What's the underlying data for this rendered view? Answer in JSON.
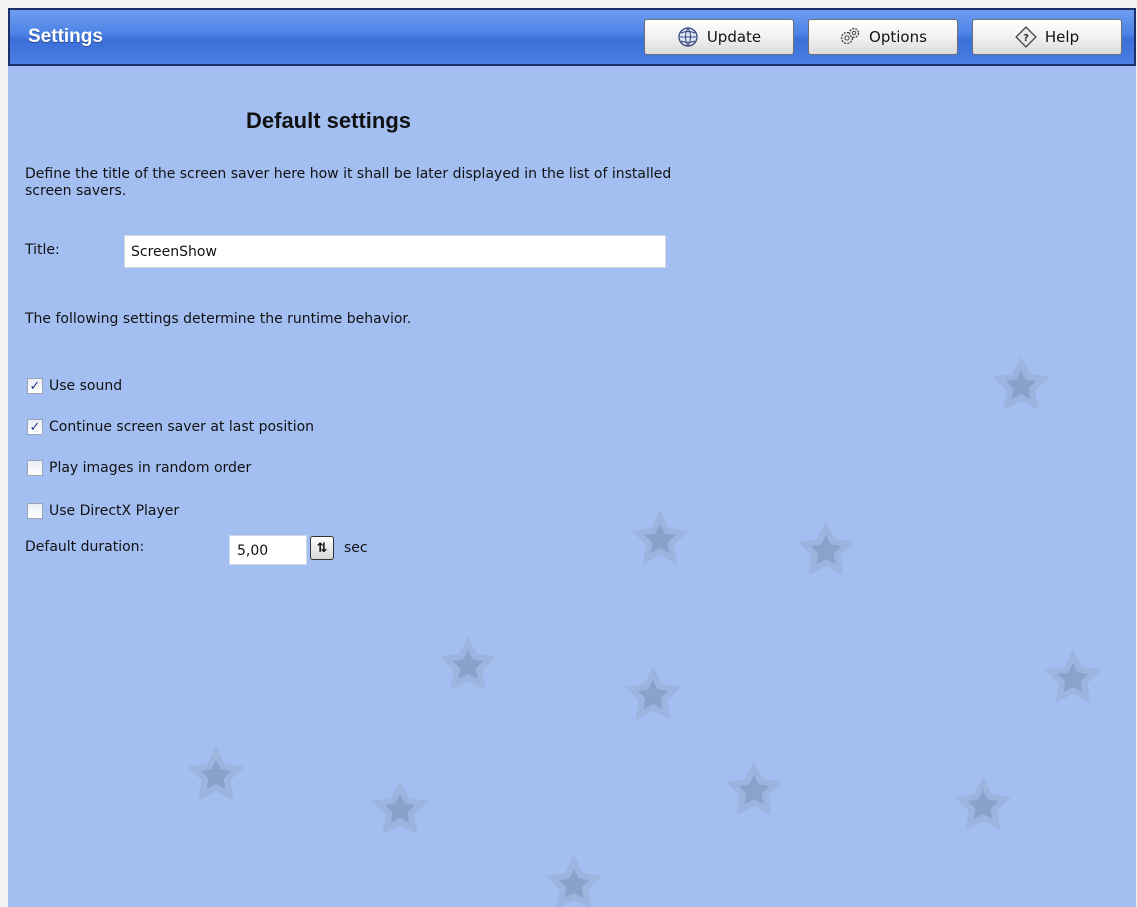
{
  "window": {
    "title": "Settings"
  },
  "toolbar": {
    "buttons": [
      {
        "label": "Update",
        "icon": "globe-update-icon"
      },
      {
        "label": "Options",
        "icon": "gears-options-icon"
      },
      {
        "label": "Help",
        "icon": "help-diamond-icon"
      }
    ]
  },
  "main": {
    "heading": "Default settings",
    "description": "Define the title of the screen saver here how it shall be later displayed in the list of installed screen savers.",
    "title_label": "Title:",
    "title_value": "ScreenShow",
    "runtime_text": "The following settings determine the runtime behavior.",
    "options": [
      {
        "label": "Use sound",
        "checked": true
      },
      {
        "label": "Continue screen saver at last position",
        "checked": true
      },
      {
        "label": "Play images in random order",
        "checked": false
      },
      {
        "label": "Use DirectX Player",
        "checked": false
      }
    ],
    "duration_label": "Default duration:",
    "duration_value": "5,00",
    "duration_unit": "sec"
  },
  "colors": {
    "background": "#a3bff2",
    "titlebar": "#4c82e6",
    "star": "#8ea4c8"
  }
}
